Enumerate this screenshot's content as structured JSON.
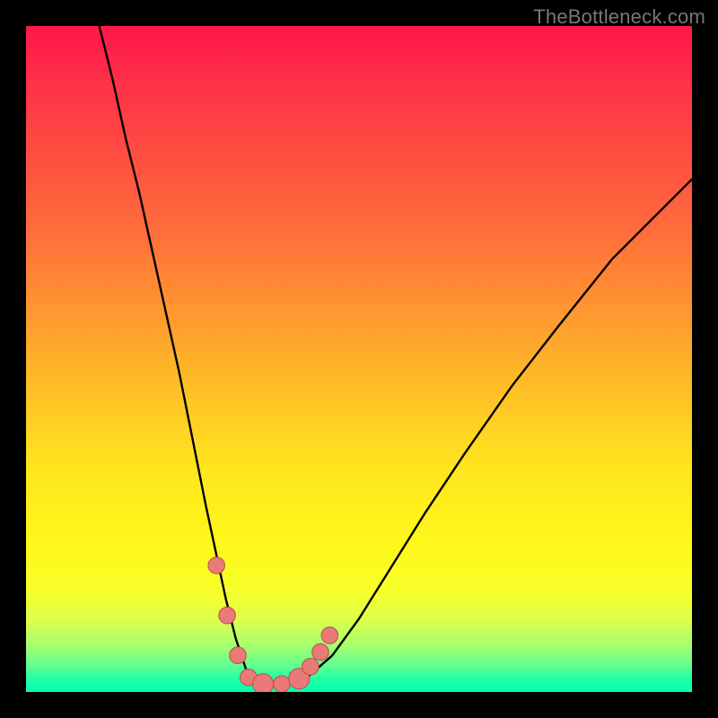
{
  "watermark": "TheBottleneck.com",
  "chart_data": {
    "type": "line",
    "title": "",
    "xlabel": "",
    "ylabel": "",
    "xlim": [
      0,
      100
    ],
    "ylim": [
      0,
      100
    ],
    "series": [
      {
        "name": "curve",
        "x": [
          11,
          13,
          15,
          17,
          19,
          21,
          23,
          25,
          27,
          28.5,
          30,
          31.5,
          33,
          34.5,
          36,
          39,
          42,
          46,
          50,
          55,
          60,
          66,
          73,
          80,
          88,
          96,
          100
        ],
        "y": [
          100,
          92,
          83,
          75,
          66,
          57,
          48,
          38,
          28,
          21,
          14,
          8,
          3.5,
          1.4,
          1.0,
          1.1,
          2.0,
          5.5,
          11,
          19,
          27,
          36,
          46,
          55,
          65,
          73,
          77
        ]
      }
    ],
    "markers": [
      {
        "x": 28.6,
        "y": 19.0,
        "r": 1.25
      },
      {
        "x": 30.2,
        "y": 11.5,
        "r": 1.25
      },
      {
        "x": 31.8,
        "y": 5.5,
        "r": 1.25
      },
      {
        "x": 33.4,
        "y": 2.2,
        "r": 1.25
      },
      {
        "x": 35.6,
        "y": 1.2,
        "r": 1.55
      },
      {
        "x": 38.4,
        "y": 1.2,
        "r": 1.25
      },
      {
        "x": 41.0,
        "y": 2.0,
        "r": 1.55
      },
      {
        "x": 42.7,
        "y": 3.8,
        "r": 1.25
      },
      {
        "x": 44.2,
        "y": 6.0,
        "r": 1.25
      },
      {
        "x": 45.6,
        "y": 8.5,
        "r": 1.25
      }
    ],
    "colors": {
      "curve_stroke": "#000000",
      "marker_fill": "#e97a78",
      "marker_stroke": "#bb4e4c"
    }
  }
}
